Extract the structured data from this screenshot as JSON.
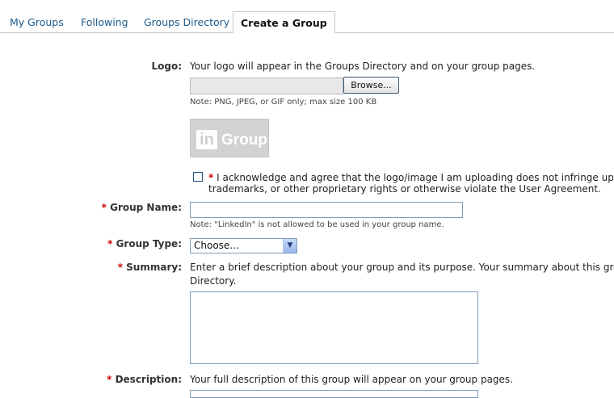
{
  "tabs": {
    "my_groups": "My Groups",
    "following": "Following",
    "directory": "Groups Directory",
    "create": "Create a Group"
  },
  "logo": {
    "label": "Logo:",
    "help": "Your logo will appear in the Groups Directory and on your group pages.",
    "browse": "Browse...",
    "note": "Note: PNG, JPEG, or GIF only; max size 100 KB",
    "placeholder_in": "in",
    "placeholder_text": "Group",
    "ack_line1": "I acknowledge and agree that the logo/image I am uploading does not infringe upon an",
    "ack_line2": "trademarks, or other proprietary rights or otherwise violate the User Agreement."
  },
  "required_mark": "*",
  "group_name": {
    "label": "Group Name:",
    "value": "",
    "note": "Note: \"LinkedIn\" is not allowed to be used in your group name."
  },
  "group_type": {
    "label": "Group Type:",
    "selected": "Choose..."
  },
  "summary": {
    "label": "Summary:",
    "help_line1": "Enter a brief description about your group and its purpose. Your summary about this group",
    "help_line2": "Directory.",
    "value": ""
  },
  "description": {
    "label": "Description:",
    "help": "Your full description of this group will appear on your group pages."
  },
  "colors": {
    "link": "#1d5a8a",
    "required": "#cc0000",
    "input_border": "#7f9db9"
  }
}
